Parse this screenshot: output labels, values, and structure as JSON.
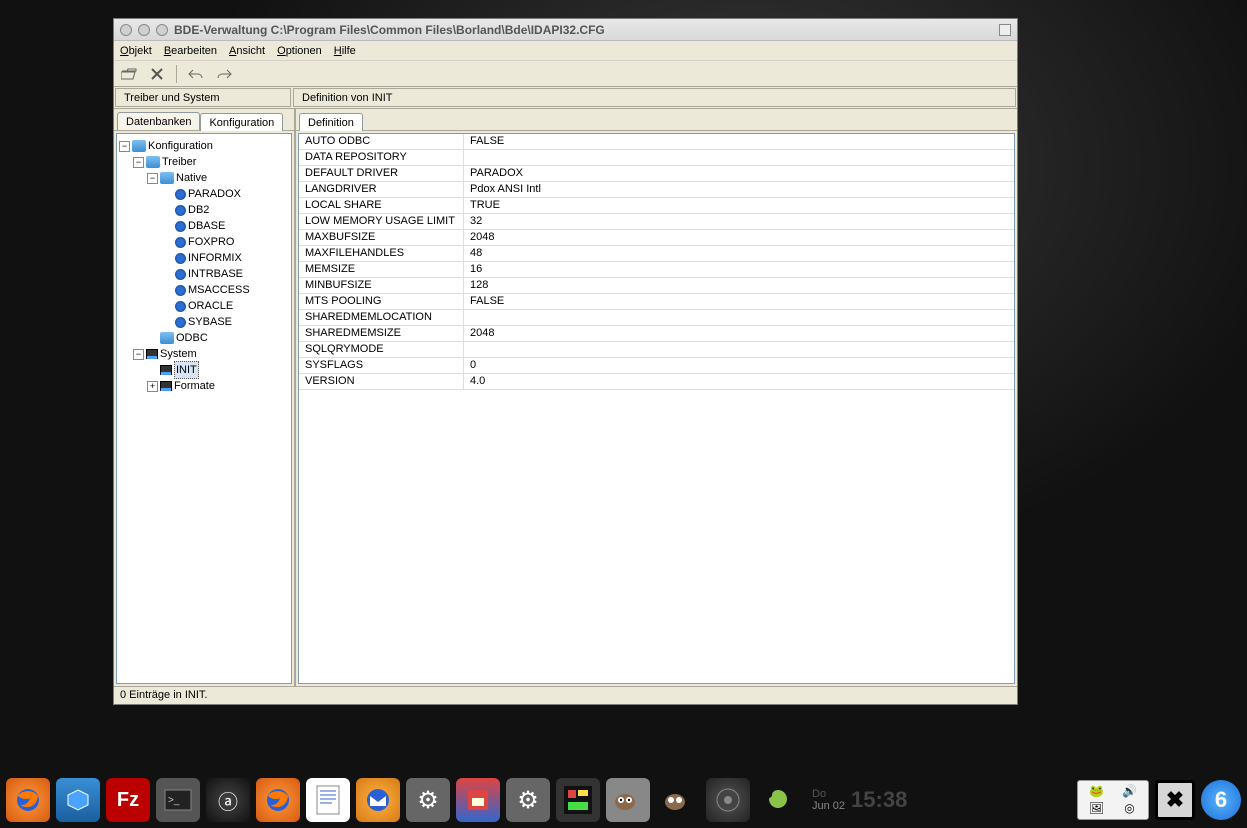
{
  "window": {
    "title": "BDE-Verwaltung  C:\\Program Files\\Common Files\\Borland\\Bde\\IDAPI32.CFG"
  },
  "menu": {
    "items": [
      "Objekt",
      "Bearbeiten",
      "Ansicht",
      "Optionen",
      "Hilfe"
    ]
  },
  "panel_headers": {
    "left": "Treiber und System",
    "right": "Definition von INIT"
  },
  "left_tabs": {
    "tab1": "Datenbanken",
    "tab2": "Konfiguration"
  },
  "right_tabs": {
    "tab1": "Definition"
  },
  "tree": {
    "root": "Konfiguration",
    "treiber": "Treiber",
    "native": "Native",
    "drivers": [
      "PARADOX",
      "DB2",
      "DBASE",
      "FOXPRO",
      "INFORMIX",
      "INTRBASE",
      "MSACCESS",
      "ORACLE",
      "SYBASE"
    ],
    "odbc": "ODBC",
    "system": "System",
    "init": "INIT",
    "formate": "Formate"
  },
  "grid": [
    {
      "key": "AUTO ODBC",
      "val": "FALSE"
    },
    {
      "key": "DATA REPOSITORY",
      "val": ""
    },
    {
      "key": "DEFAULT DRIVER",
      "val": "PARADOX"
    },
    {
      "key": "LANGDRIVER",
      "val": "Pdox ANSI Intl"
    },
    {
      "key": "LOCAL SHARE",
      "val": "TRUE"
    },
    {
      "key": "LOW MEMORY USAGE LIMIT",
      "val": "32"
    },
    {
      "key": "MAXBUFSIZE",
      "val": "2048"
    },
    {
      "key": "MAXFILEHANDLES",
      "val": "48"
    },
    {
      "key": "MEMSIZE",
      "val": "16"
    },
    {
      "key": "MINBUFSIZE",
      "val": "128"
    },
    {
      "key": "MTS POOLING",
      "val": "FALSE"
    },
    {
      "key": "SHAREDMEMLOCATION",
      "val": ""
    },
    {
      "key": "SHAREDMEMSIZE",
      "val": "2048"
    },
    {
      "key": "SQLQRYMODE",
      "val": ""
    },
    {
      "key": "SYSFLAGS",
      "val": "0"
    },
    {
      "key": "VERSION",
      "val": "4.0"
    }
  ],
  "status": "0 Einträge in INIT.",
  "taskbar": {
    "day": "Do",
    "date": "Jun 02",
    "time": "15:38",
    "workspace": "6"
  }
}
